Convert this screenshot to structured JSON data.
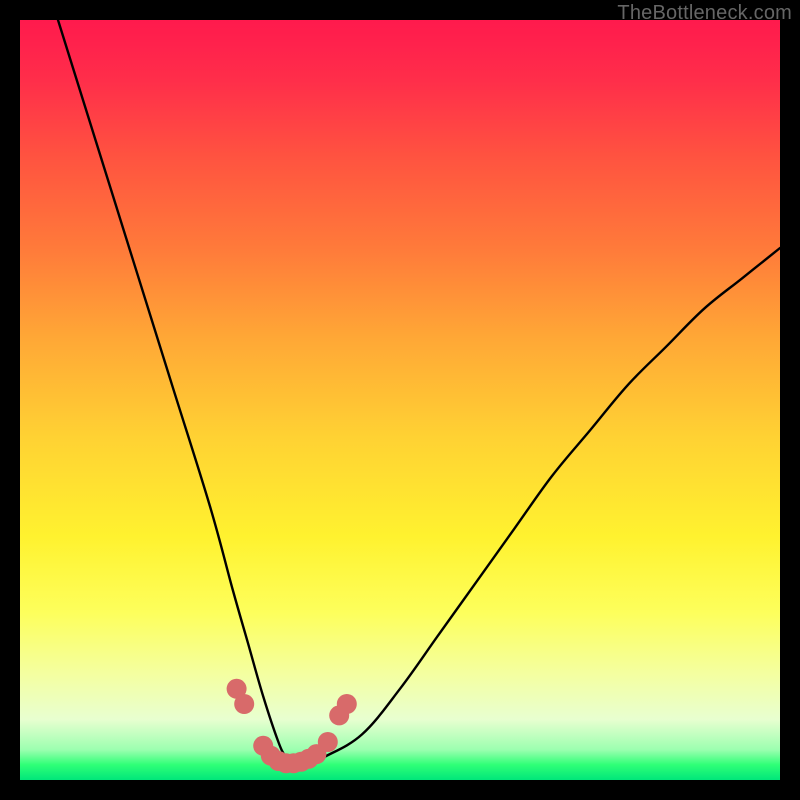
{
  "watermark": "TheBottleneck.com",
  "chart_data": {
    "type": "line",
    "title": "",
    "xlabel": "",
    "ylabel": "",
    "xlim": [
      0,
      100
    ],
    "ylim": [
      0,
      100
    ],
    "series": [
      {
        "name": "curve",
        "x": [
          5,
          10,
          15,
          20,
          25,
          28,
          30,
          32,
          34,
          35,
          36,
          38,
          40,
          45,
          50,
          55,
          60,
          65,
          70,
          75,
          80,
          85,
          90,
          95,
          100
        ],
        "values": [
          100,
          84,
          68,
          52,
          36,
          25,
          18,
          11,
          5,
          3,
          2,
          2,
          3,
          6,
          12,
          19,
          26,
          33,
          40,
          46,
          52,
          57,
          62,
          66,
          70
        ]
      }
    ],
    "markers": {
      "name": "dots",
      "x": [
        28.5,
        29.5,
        32.0,
        33.0,
        34.0,
        35.0,
        36.0,
        37.0,
        38.0,
        39.0,
        40.5,
        42.0,
        43.0
      ],
      "values": [
        12.0,
        10.0,
        4.5,
        3.2,
        2.5,
        2.2,
        2.2,
        2.4,
        2.8,
        3.4,
        5.0,
        8.5,
        10.0
      ]
    },
    "colors": {
      "gradient_top": "#ff1a4d",
      "gradient_bottom": "#00e67a",
      "curve": "#000000",
      "marker": "#d86a6a"
    }
  }
}
